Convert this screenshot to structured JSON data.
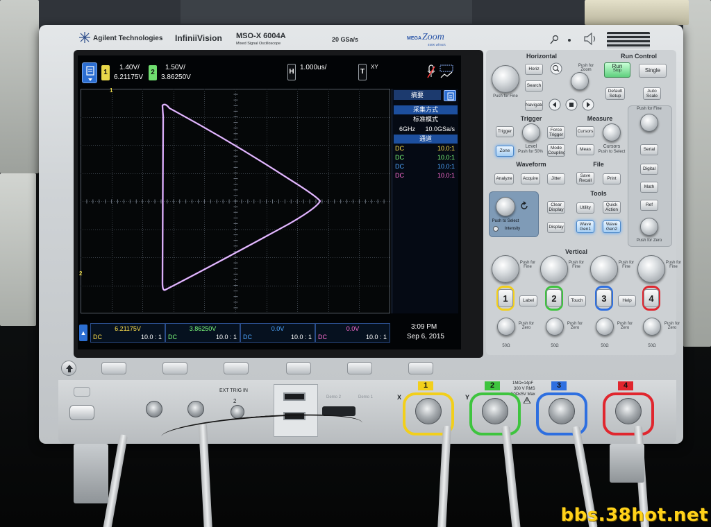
{
  "header": {
    "brand": "Agilent Technologies",
    "series": "InfiniiVision",
    "model": "MSO-X 6004A",
    "model_sub": "Mixed Signal Oscilloscope",
    "sample_rate": "20 GSa/s",
    "megazoom_a": "MEGA",
    "megazoom_b": "Zoom",
    "megazoom_c": "450K wfms/s"
  },
  "display": {
    "ch1_chip": "1",
    "ch1_scale": "1.40V/",
    "ch1_offset": "6.21175V",
    "ch2_chip": "2",
    "ch2_scale": "1.50V/",
    "ch2_offset": "3.86250V",
    "horiz_chip": "H",
    "time_scale": "1.000us/",
    "trig_chip": "T",
    "trig_mode": "XY",
    "ch1_marker": "1",
    "ch2_marker": "2",
    "side_panel": {
      "tab": "摘要",
      "acq_title": "采集方式",
      "acq_mode": "标准模式",
      "bandwidth": "6GHz",
      "srate": "10.0GSa/s",
      "channels_title": "通道",
      "rows": [
        {
          "coupling": "DC",
          "probe": "10.0:1",
          "color": "#ffe14d"
        },
        {
          "coupling": "DC",
          "probe": "10.0:1",
          "color": "#7dff7d"
        },
        {
          "coupling": "DC",
          "probe": "10.0:1",
          "color": "#4fa7ff"
        },
        {
          "coupling": "DC",
          "probe": "10.0:1",
          "color": "#ff6fd4"
        }
      ]
    },
    "footer": [
      {
        "value": "6.21175V",
        "coupling": "DC",
        "probe": "10.0 : 1",
        "color": "#ffe14d"
      },
      {
        "value": "3.86250V",
        "coupling": "DC",
        "probe": "10.0 : 1",
        "color": "#7dff7d"
      },
      {
        "value": "0.0V",
        "coupling": "DC",
        "probe": "10.0 : 1",
        "color": "#4fa7ff"
      },
      {
        "value": "0.0V",
        "coupling": "DC",
        "probe": "10.0 : 1",
        "color": "#ff6fd4"
      }
    ],
    "time": "3:09 PM",
    "date": "Sep 6, 2015"
  },
  "panel": {
    "horizontal": {
      "title": "Horizontal",
      "horiz": "Horiz",
      "search": "Search",
      "navigate": "Navigate",
      "push_zoom": "Push for Zoom",
      "push_fine": "Push for Fine"
    },
    "run_control": {
      "title": "Run Control",
      "run": "Run",
      "stop": "Stop",
      "single": "Single",
      "default": "Default Setup",
      "auto": "Auto Scale"
    },
    "trigger": {
      "title": "Trigger",
      "trigger": "Trigger",
      "force": "Force Trigger",
      "zone": "Zone",
      "level": "Level",
      "push50": "Push for 50%",
      "mode": "Mode Coupling"
    },
    "measure": {
      "title": "Measure",
      "cursors_btn": "Cursors",
      "meas": "Meas",
      "cursors": "Cursors",
      "push_select": "Push to Select"
    },
    "waveform": {
      "title": "Waveform",
      "analyze": "Analyze",
      "acquire": "Acquire",
      "jitter": "Jitter"
    },
    "file": {
      "title": "File",
      "save": "Save Recall",
      "print": "Print"
    },
    "tools": {
      "title": "Tools",
      "utility": "Utility",
      "quick": "Quick Action",
      "clear": "Clear Display",
      "display": "Display",
      "wgen1": "Wave Gen1",
      "wgen2": "Wave Gen2"
    },
    "entry": {
      "push_select": "Push to Select",
      "intensity": "Intensity"
    },
    "side": {
      "push_fine": "Push for Fine",
      "serial": "Serial",
      "digital": "Digital",
      "math": "Math",
      "ref": "Ref",
      "push_zero": "Push for Zero"
    },
    "vertical": {
      "title": "Vertical",
      "label": "Label",
      "touch": "Touch",
      "help": "Help",
      "push_fine": "Push for Fine",
      "push_zero": "Push for Zero",
      "ohm": "50Ω"
    },
    "channels": [
      {
        "num": "1",
        "color": "#f2cf1b"
      },
      {
        "num": "2",
        "color": "#3ec43e"
      },
      {
        "num": "3",
        "color": "#2e6fe0"
      },
      {
        "num": "4",
        "color": "#e0262e"
      }
    ]
  },
  "front": {
    "x_label": "X",
    "y_label": "Y",
    "ext_trig": "EXT TRIG IN",
    "ext_num": "2",
    "demo1": "Demo 1",
    "demo2": "Demo 2",
    "spec1": "1MΩ=14pF",
    "spec2": "300 V RMS",
    "spec3": "50Ω≤5V Max"
  },
  "watermark": "bbs.38hot.net"
}
